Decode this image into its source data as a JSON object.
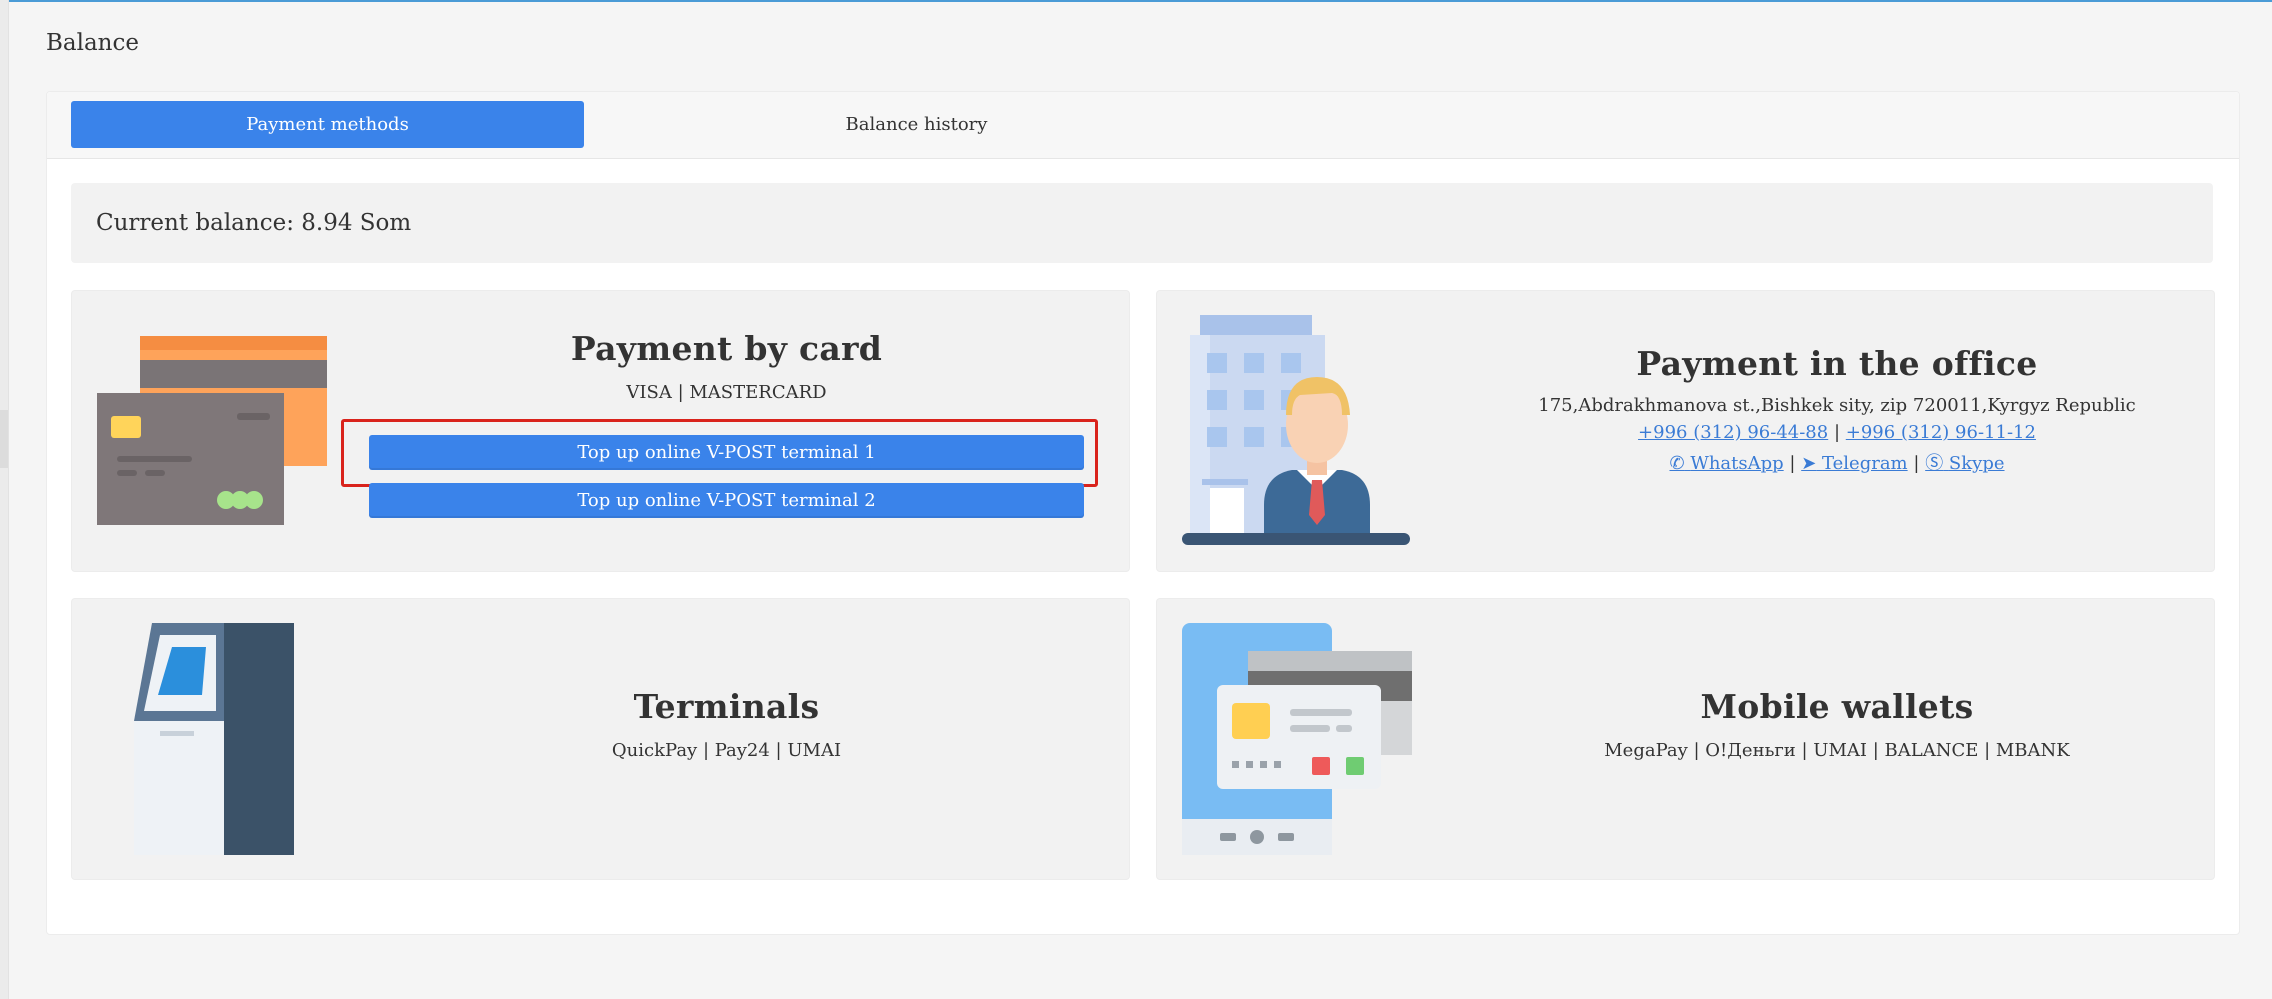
{
  "page": {
    "title": "Balance"
  },
  "tabs": [
    {
      "label": "Payment methods",
      "active": true
    },
    {
      "label": "Balance history",
      "active": false
    }
  ],
  "balance": {
    "text": "Current balance: 8.94 Som"
  },
  "card_payment": {
    "title": "Payment by card",
    "subtitle": "VISA | MASTERCARD",
    "buttons": [
      "Top up online V-POST terminal 1",
      "Top up online V-POST terminal 2"
    ]
  },
  "office_payment": {
    "title": "Payment in the office",
    "address": "175,Abdrakhmanova st.,Bishkek sity, zip 720011,Kyrgyz Republic",
    "phone1": "+996 (312) 96-44-88",
    "phone2": "+996 (312) 96-11-12",
    "sep": "|",
    "whatsapp": "WhatsApp",
    "telegram": "Telegram",
    "skype": "Skype"
  },
  "terminals": {
    "title": "Terminals",
    "subtitle": "QuickPay | Pay24 | UMAI"
  },
  "mobile_wallets": {
    "title": "Mobile wallets",
    "subtitle": "MegaPay | О!Деньги | UMAI | BALANCE | MBANK"
  },
  "colors": {
    "accent": "#3a83ea",
    "highlight": "#d9231c",
    "link": "#3a7bd5"
  }
}
